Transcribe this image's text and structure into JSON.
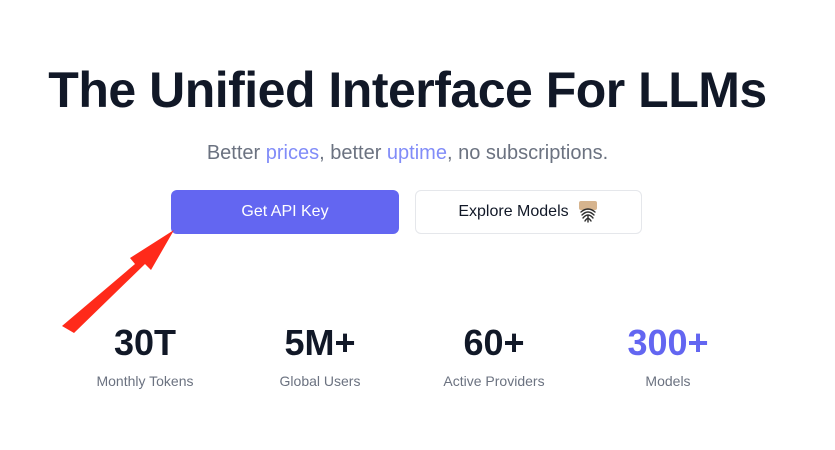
{
  "hero": {
    "title": "The Unified Interface For LLMs",
    "subtitle": {
      "part1": "Better ",
      "link1": "prices",
      "part2": ", better ",
      "link2": "uptime",
      "part3": ", no subscriptions."
    }
  },
  "buttons": {
    "primary_label": "Get API Key",
    "secondary_label": "Explore Models",
    "secondary_icon": "fingerprint-icon"
  },
  "stats": [
    {
      "value": "30T",
      "label": "Monthly Tokens"
    },
    {
      "value": "5M+",
      "label": "Global Users"
    },
    {
      "value": "60+",
      "label": "Active Providers"
    },
    {
      "value": "300+",
      "label": "Models"
    }
  ],
  "colors": {
    "accent": "#6366f1",
    "highlight_text": "#818cf8",
    "annotation_arrow": "#ff2a1a"
  }
}
